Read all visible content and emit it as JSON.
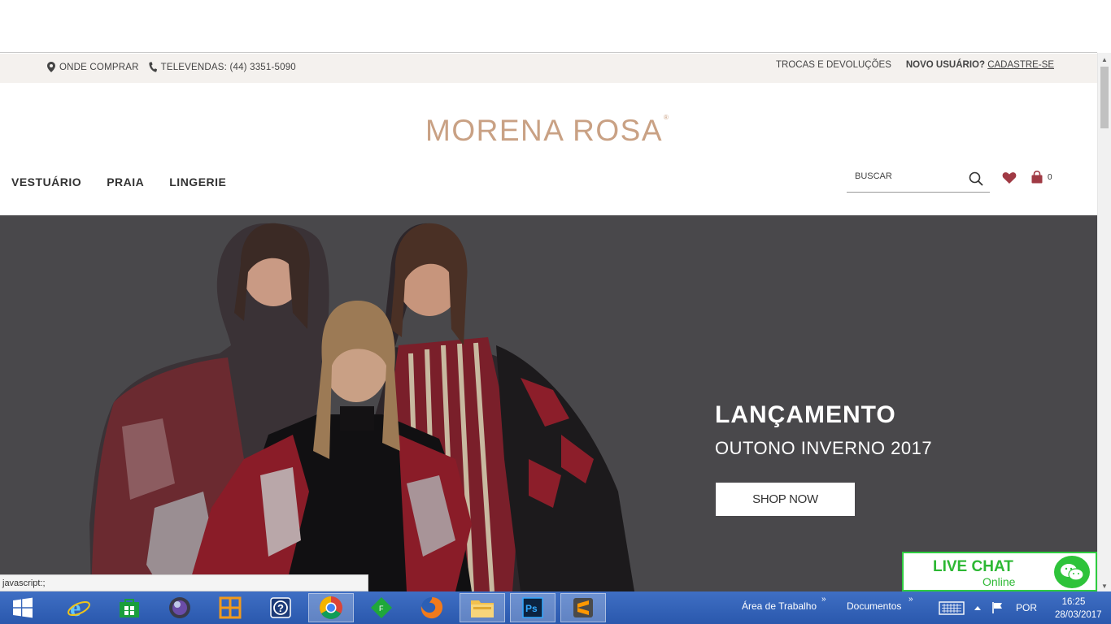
{
  "utility_bar": {
    "where_to_buy": "ONDE COMPRAR",
    "telesales": "TELEVENDAS: (44) 3351-5090",
    "returns": "TROCAS E DEVOLUÇÕES",
    "new_user": "NOVO USUÁRIO?",
    "signup": "CADASTRE-SE"
  },
  "header": {
    "logo": "MORENA ROSA",
    "logo_mark": "®",
    "nav": [
      "VESTUÁRIO",
      "PRAIA",
      "LINGERIE"
    ],
    "search_placeholder": "BUSCAR",
    "cart_count": "0"
  },
  "hero": {
    "title": "LANÇAMENTO",
    "subtitle": "OUTONO INVERNO 2017",
    "cta": "SHOP NOW"
  },
  "live_chat": {
    "title": "LIVE CHAT",
    "status": "Online"
  },
  "status_bar": {
    "url": "javascript:;"
  },
  "taskbar": {
    "apps": [
      "windows-start",
      "internet-explorer",
      "windows-store",
      "media-player",
      "office-app",
      "help-app",
      "chrome",
      "green-app",
      "firefox",
      "file-explorer",
      "photoshop",
      "sublime-text"
    ],
    "toolbar_desktop": "Área de Trabalho",
    "toolbar_documents": "Documentos",
    "language": "POR",
    "time": "16:25",
    "date": "28/03/2017"
  },
  "colors": {
    "brand": "#c9a184",
    "hero_bg": "#49484b",
    "accent_icon": "#a03a44",
    "live_chat": "#2db834",
    "taskbar": "#3566bb"
  }
}
